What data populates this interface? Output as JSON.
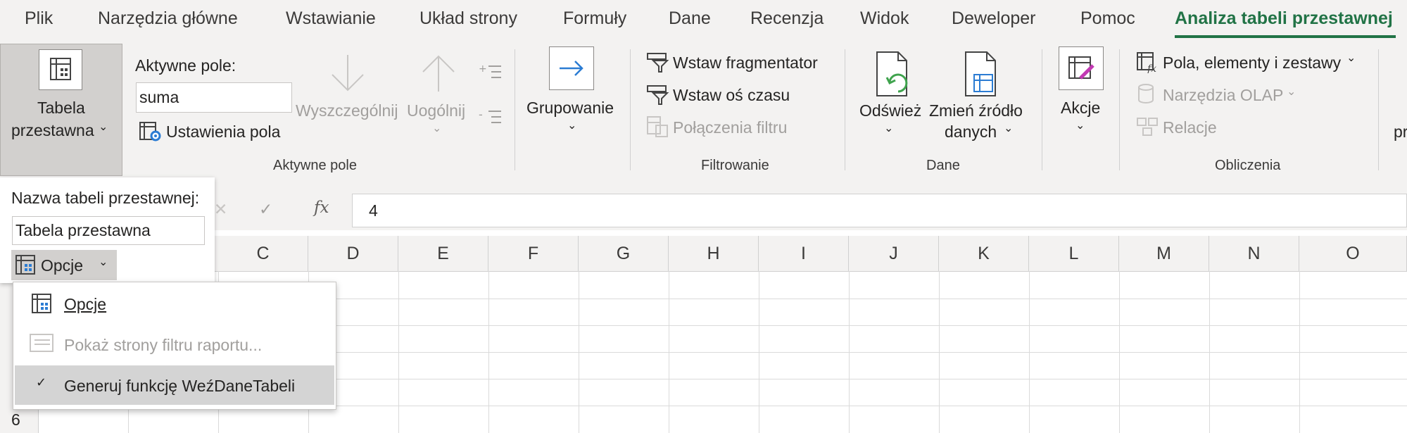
{
  "tabs": [
    {
      "label": "Plik"
    },
    {
      "label": "Narzędzia główne"
    },
    {
      "label": "Wstawianie"
    },
    {
      "label": "Układ strony"
    },
    {
      "label": "Formuły"
    },
    {
      "label": "Dane"
    },
    {
      "label": "Recenzja"
    },
    {
      "label": "Widok"
    },
    {
      "label": "Deweloper"
    },
    {
      "label": "Pomoc"
    },
    {
      "label": "Analiza tabeli przestawnej"
    }
  ],
  "ribbon": {
    "pivot_table": {
      "line1": "Tabela",
      "line2": "przestawna"
    },
    "active_field": {
      "label": "Aktywne pole:",
      "value": "suma",
      "settings": "Ustawienia pola",
      "drill_down": "Wyszczególnij",
      "drill_up": "Uogólnij",
      "group_label": "Aktywne pole"
    },
    "grouping": {
      "label": "Grupowanie"
    },
    "filter": {
      "slicer": "Wstaw fragmentator",
      "timeline": "Wstaw oś czasu",
      "connections": "Połączenia filtru",
      "group_label": "Filtrowanie"
    },
    "data": {
      "refresh": "Odśwież",
      "change_source_1": "Zmień źródło",
      "change_source_2": "danych",
      "group_label": "Dane"
    },
    "actions": {
      "label": "Akcje"
    },
    "calculations": {
      "fields": "Pola, elementy i zestawy",
      "olap": "Narzędzia OLAP",
      "relations": "Relacje",
      "group_label": "Obliczenia"
    },
    "cut_text": "pr"
  },
  "formula_bar": {
    "fx": "fx",
    "value": "4"
  },
  "columns": [
    "C",
    "D",
    "E",
    "F",
    "G",
    "H",
    "I",
    "J",
    "K",
    "L",
    "M",
    "N",
    "O"
  ],
  "row_visible": "6",
  "pivot_panel": {
    "name_label": "Nazwa tabeli przestawnej:",
    "name_value": "Tabela przestawna",
    "options_button": "Opcje"
  },
  "options_menu": [
    {
      "label": "Opcje",
      "enabled": true
    },
    {
      "label": "Pokaż strony filtru raportu...",
      "enabled": false
    },
    {
      "label": "Generuj funkcję WeźDaneTabeli",
      "enabled": true,
      "checked": true
    }
  ],
  "colors": {
    "accent": "#217346",
    "disabled": "#a19f9d",
    "ribbon_bg": "#f3f2f1"
  }
}
